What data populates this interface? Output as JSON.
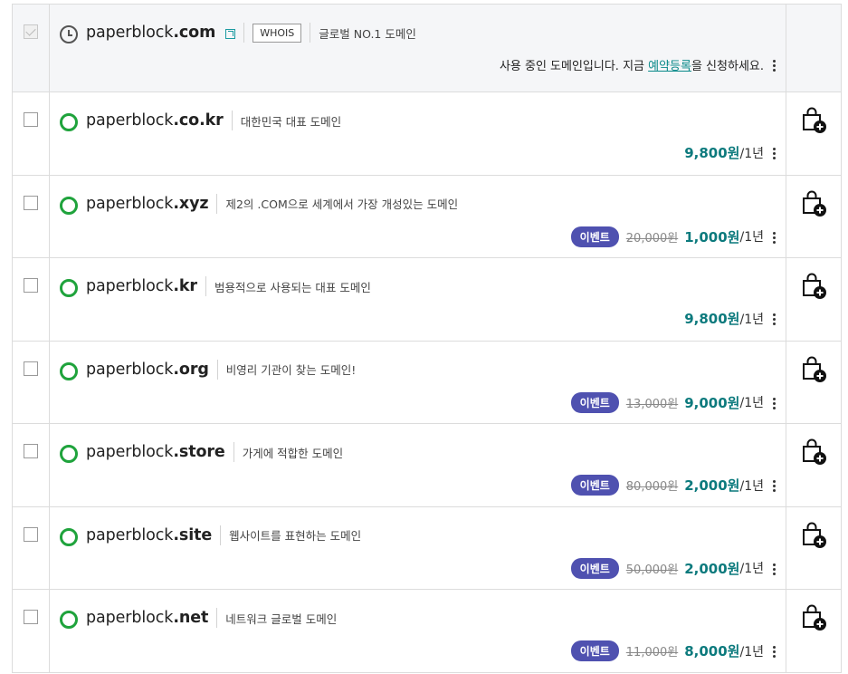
{
  "taken": {
    "sld": "paperblock",
    "tld": ".com",
    "whois_label": "WHOIS",
    "desc": "글로벌 NO.1 도메인",
    "notice_pre": "사용 중인 도메인입니다. 지금 ",
    "notice_link": "예약등록",
    "notice_post": "을 신청하세요."
  },
  "rows": [
    {
      "sld": "paperblock",
      "tld": ".co.kr",
      "desc": "대한민국 대표 도메인",
      "badge": "",
      "orig": "",
      "price": "9,800원",
      "unit": "/1년"
    },
    {
      "sld": "paperblock",
      "tld": ".xyz",
      "desc": "제2의 .COM으로 세계에서 가장 개성있는 도메인",
      "badge": "이벤트",
      "orig": "20,000원",
      "price": "1,000원",
      "unit": "/1년"
    },
    {
      "sld": "paperblock",
      "tld": ".kr",
      "desc": "범용적으로 사용되는 대표 도메인",
      "badge": "",
      "orig": "",
      "price": "9,800원",
      "unit": "/1년"
    },
    {
      "sld": "paperblock",
      "tld": ".org",
      "desc": "비영리 기관이 찾는 도메인!",
      "badge": "이벤트",
      "orig": "13,000원",
      "price": "9,000원",
      "unit": "/1년"
    },
    {
      "sld": "paperblock",
      "tld": ".store",
      "desc": "가게에 적합한 도메인",
      "badge": "이벤트",
      "orig": "80,000원",
      "price": "2,000원",
      "unit": "/1년"
    },
    {
      "sld": "paperblock",
      "tld": ".site",
      "desc": "웹사이트를 표현하는 도메인",
      "badge": "이벤트",
      "orig": "50,000원",
      "price": "2,000원",
      "unit": "/1년"
    },
    {
      "sld": "paperblock",
      "tld": ".net",
      "desc": "네트워크 글로벌 도메인",
      "badge": "이벤트",
      "orig": "11,000원",
      "price": "8,000원",
      "unit": "/1년"
    }
  ],
  "icons": {
    "status_taken": "clock-icon",
    "status_available": "available-circle-icon",
    "external": "external-link-icon",
    "more": "kebab-menu-icon",
    "cart": "add-to-cart-bag-icon"
  },
  "colors": {
    "price": "#0c7a7d",
    "badge": "#4f51b0",
    "available": "#1fa33c",
    "link": "#0a8a8a"
  }
}
